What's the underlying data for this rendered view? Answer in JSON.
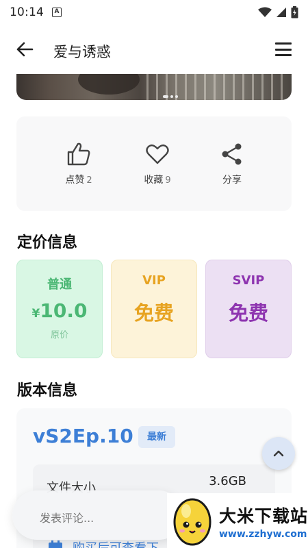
{
  "status_bar": {
    "time": "10:14",
    "notification_icon_letter": "A"
  },
  "header": {
    "title": "爱与诱惑"
  },
  "actions": [
    {
      "label": "点赞",
      "count": "2",
      "icon": "thumbs-up-icon"
    },
    {
      "label": "收藏",
      "count": "9",
      "icon": "heart-icon"
    },
    {
      "label": "分享",
      "count": "",
      "icon": "share-icon"
    }
  ],
  "pricing": {
    "title": "定价信息",
    "normal": {
      "tier": "普通",
      "currency": "¥",
      "amount": "10.0",
      "note": "原价"
    },
    "vip": {
      "tier": "VIP",
      "value": "免费"
    },
    "svip": {
      "tier": "SVIP",
      "value": "免费"
    }
  },
  "version": {
    "title": "版本信息",
    "name": "vS2Ep.10",
    "badge": "最新",
    "file_size_label": "文件大小",
    "file_size_value": "3.6GB",
    "buy_text": "购买后可查看下"
  },
  "comment": {
    "placeholder": "发表评论..."
  },
  "watermark": {
    "title": "大米下载站",
    "url": "www.zzhyw.com"
  },
  "colors": {
    "accent_blue": "#3d7fd6",
    "normal_green": "#4bb774",
    "vip_gold": "#e7a321",
    "svip_purple": "#8e35b0"
  }
}
